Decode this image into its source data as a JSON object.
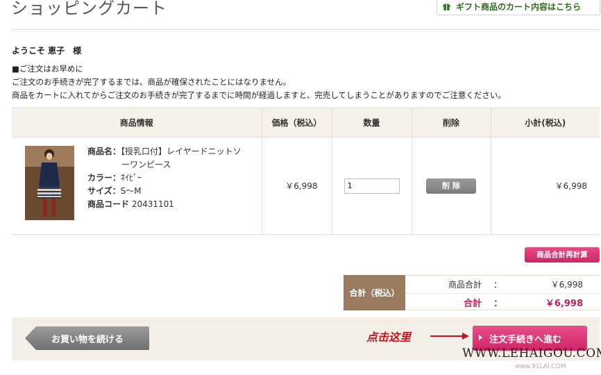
{
  "page": {
    "title": "ショッピングカート",
    "gift_link": "ギフト商品のカート内容はこちら",
    "welcome": "ようこそ 恵子　様",
    "notice_lines": [
      "■ご注文はお早めに",
      "ご注文のお手続きが完了するまでは、商品が確保されたことにはなりません。",
      "商品をカートに入れてからご注文のお手続きが完了するまでに時間が経過しますと、完売してしまうことがありますのでご注意ください。"
    ]
  },
  "cart": {
    "columns": [
      "商品情報",
      "価格（税込）",
      "数量",
      "削除",
      "小計(税込)"
    ],
    "items": [
      {
        "name_label": "商品名：",
        "name_line1": "【授乳口付】レイヤードニットソ",
        "name_line2": "ーワンピース",
        "color_label": "カラー：",
        "color": "ﾈｲﾋﾞｰ",
        "size_label": "サイズ：",
        "size": "S～M",
        "code_label": "商品コード",
        "code": "20431101",
        "price": "￥6,998",
        "quantity": "1",
        "delete_label": "削除",
        "subtotal": "￥6,998"
      }
    ],
    "recalc_label": "商品合計再計算"
  },
  "totals": {
    "label": "合計（税込）",
    "items_label": "商品合計",
    "items_value": "￥6,998",
    "grand_label": "合計",
    "grand_value": "￥6,998",
    "colon": "："
  },
  "actions": {
    "continue_label": "お買い物を続ける",
    "annotation": "点击这里",
    "checkout_label": "注文手続きへ進む"
  },
  "watermark": {
    "line1": "WWW.LEHAIGOU.COM",
    "line2": "www.91LAI.COM"
  },
  "colors": {
    "accent_pink": "#cf2566",
    "total_brown": "#9a7b5f",
    "annotation_red": "#c4121f",
    "gift_green": "#2f6b1f"
  }
}
